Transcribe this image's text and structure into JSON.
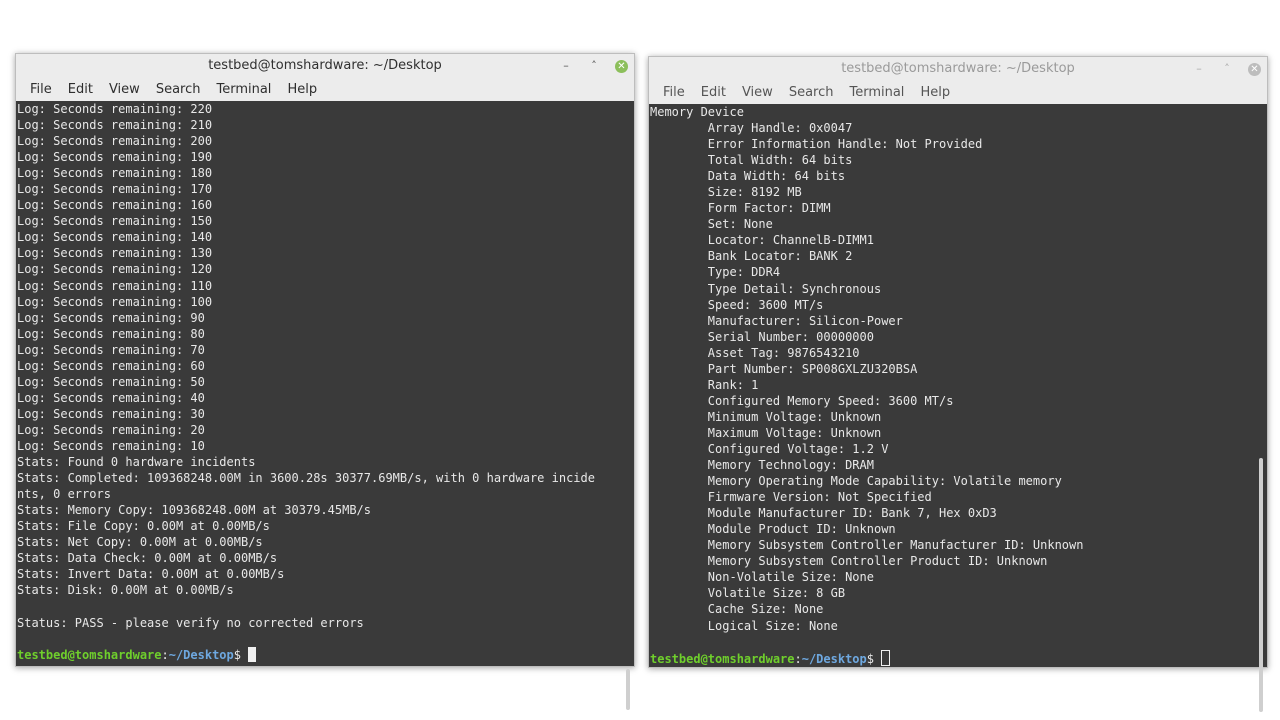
{
  "left_window": {
    "title": "testbed@tomshardware: ~/Desktop",
    "controls": {
      "minimize": "–",
      "maximize": "˄",
      "close": "✕"
    },
    "menu": [
      "File",
      "Edit",
      "View",
      "Search",
      "Terminal",
      "Help"
    ],
    "lines": [
      "Log: Seconds remaining: 220",
      "Log: Seconds remaining: 210",
      "Log: Seconds remaining: 200",
      "Log: Seconds remaining: 190",
      "Log: Seconds remaining: 180",
      "Log: Seconds remaining: 170",
      "Log: Seconds remaining: 160",
      "Log: Seconds remaining: 150",
      "Log: Seconds remaining: 140",
      "Log: Seconds remaining: 130",
      "Log: Seconds remaining: 120",
      "Log: Seconds remaining: 110",
      "Log: Seconds remaining: 100",
      "Log: Seconds remaining: 90",
      "Log: Seconds remaining: 80",
      "Log: Seconds remaining: 70",
      "Log: Seconds remaining: 60",
      "Log: Seconds remaining: 50",
      "Log: Seconds remaining: 40",
      "Log: Seconds remaining: 30",
      "Log: Seconds remaining: 20",
      "Log: Seconds remaining: 10",
      "Stats: Found 0 hardware incidents",
      "Stats: Completed: 109368248.00M in 3600.28s 30377.69MB/s, with 0 hardware incide",
      "nts, 0 errors",
      "Stats: Memory Copy: 109368248.00M at 30379.45MB/s",
      "Stats: File Copy: 0.00M at 0.00MB/s",
      "Stats: Net Copy: 0.00M at 0.00MB/s",
      "Stats: Data Check: 0.00M at 0.00MB/s",
      "Stats: Invert Data: 0.00M at 0.00MB/s",
      "Stats: Disk: 0.00M at 0.00MB/s",
      "",
      "Status: PASS - please verify no corrected errors",
      ""
    ],
    "prompt": {
      "user_host": "testbed@tomshardware",
      "colon": ":",
      "path": "~/Desktop",
      "symbol": "$ "
    }
  },
  "right_window": {
    "title": "testbed@tomshardware: ~/Desktop",
    "controls": {
      "minimize": "–",
      "maximize": "˄",
      "close": "✕"
    },
    "menu": [
      "File",
      "Edit",
      "View",
      "Search",
      "Terminal",
      "Help"
    ],
    "lines": [
      "Memory Device",
      "        Array Handle: 0x0047",
      "        Error Information Handle: Not Provided",
      "        Total Width: 64 bits",
      "        Data Width: 64 bits",
      "        Size: 8192 MB",
      "        Form Factor: DIMM",
      "        Set: None",
      "        Locator: ChannelB-DIMM1",
      "        Bank Locator: BANK 2",
      "        Type: DDR4",
      "        Type Detail: Synchronous",
      "        Speed: 3600 MT/s",
      "        Manufacturer: Silicon-Power",
      "        Serial Number: 00000000",
      "        Asset Tag: 9876543210",
      "        Part Number: SP008GXLZU320BSA",
      "        Rank: 1",
      "        Configured Memory Speed: 3600 MT/s",
      "        Minimum Voltage: Unknown",
      "        Maximum Voltage: Unknown",
      "        Configured Voltage: 1.2 V",
      "        Memory Technology: DRAM",
      "        Memory Operating Mode Capability: Volatile memory",
      "        Firmware Version: Not Specified",
      "        Module Manufacturer ID: Bank 7, Hex 0xD3",
      "        Module Product ID: Unknown",
      "        Memory Subsystem Controller Manufacturer ID: Unknown",
      "        Memory Subsystem Controller Product ID: Unknown",
      "        Non-Volatile Size: None",
      "        Volatile Size: 8 GB",
      "        Cache Size: None",
      "        Logical Size: None",
      ""
    ],
    "prompt": {
      "user_host": "testbed@tomshardware",
      "colon": ":",
      "path": "~/Desktop",
      "symbol": "$ "
    }
  }
}
